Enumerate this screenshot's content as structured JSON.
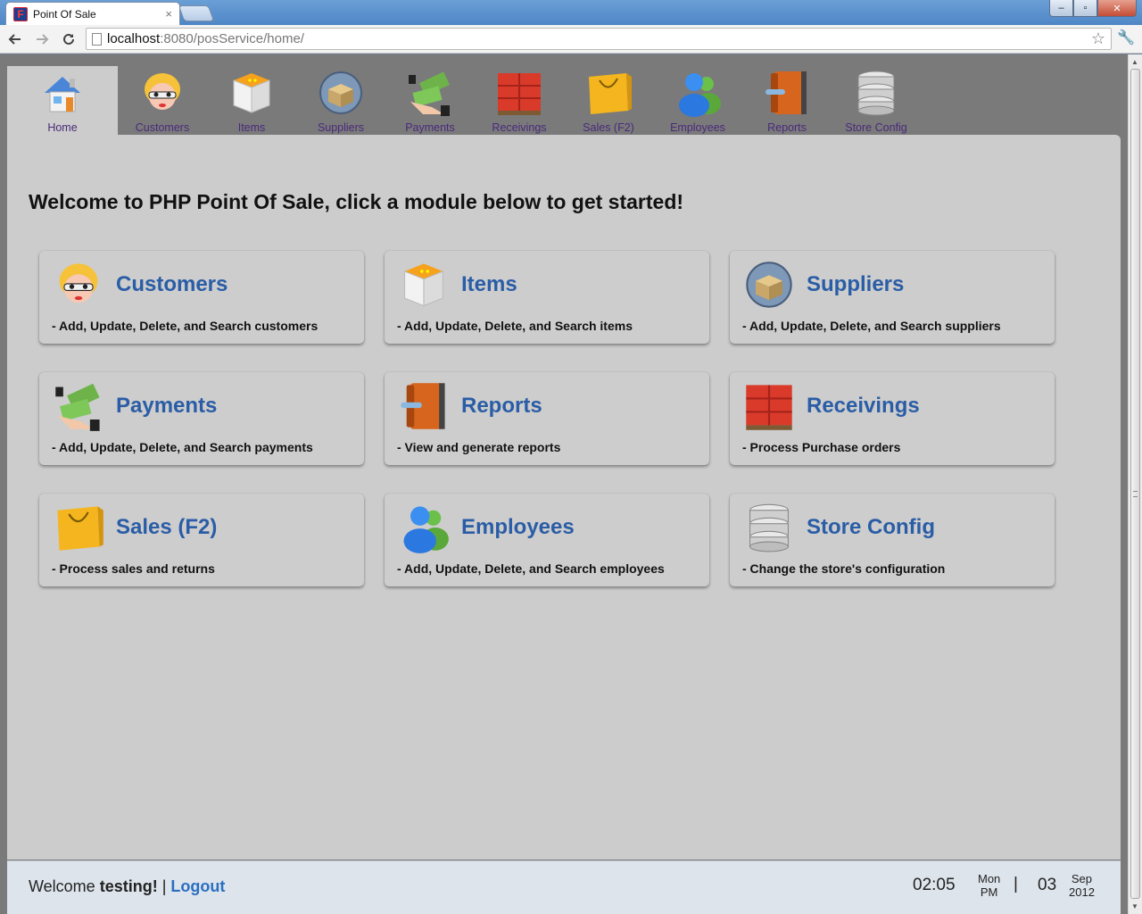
{
  "browser": {
    "tab_title": "Point Of Sale",
    "tab_close": "×",
    "favicon_glyph": "F",
    "url_host": "localhost",
    "url_rest": ":8080/posService/home/",
    "window_min": "–",
    "window_max": "▫",
    "window_close": "✕"
  },
  "menu": [
    {
      "id": "home",
      "label": "Home",
      "active": true
    },
    {
      "id": "customers",
      "label": "Customers"
    },
    {
      "id": "items",
      "label": "Items"
    },
    {
      "id": "suppliers",
      "label": "Suppliers"
    },
    {
      "id": "payments",
      "label": "Payments"
    },
    {
      "id": "receivings",
      "label": "Receivings"
    },
    {
      "id": "sales",
      "label": "Sales (F2)"
    },
    {
      "id": "employees",
      "label": "Employees"
    },
    {
      "id": "reports",
      "label": "Reports"
    },
    {
      "id": "config",
      "label": "Store Config"
    }
  ],
  "main": {
    "heading": "Welcome to PHP Point Of Sale, click a module below to get started!",
    "modules": [
      {
        "id": "customers",
        "title": "Customers",
        "desc": "- Add, Update, Delete, and Search customers"
      },
      {
        "id": "items",
        "title": "Items",
        "desc": "- Add, Update, Delete, and Search items"
      },
      {
        "id": "suppliers",
        "title": "Suppliers",
        "desc": "- Add, Update, Delete, and Search suppliers"
      },
      {
        "id": "payments",
        "title": "Payments",
        "desc": "- Add, Update, Delete, and Search payments"
      },
      {
        "id": "reports",
        "title": "Reports",
        "desc": "- View and generate reports"
      },
      {
        "id": "receivings",
        "title": "Receivings",
        "desc": "- Process Purchase orders"
      },
      {
        "id": "sales",
        "title": "Sales (F2)",
        "desc": "- Process sales and returns"
      },
      {
        "id": "employees",
        "title": "Employees",
        "desc": "- Add, Update, Delete, and Search employees"
      },
      {
        "id": "config",
        "title": "Store Config",
        "desc": "- Change the store's configuration"
      }
    ]
  },
  "footer": {
    "welcome_prefix": "Welcome ",
    "username": "testing!",
    "separator": " | ",
    "logout": "Logout",
    "time": "02:05",
    "weekday": "Mon",
    "ampm": "PM",
    "divider": "|",
    "day": "03",
    "month": "Sep",
    "year": "2012"
  }
}
